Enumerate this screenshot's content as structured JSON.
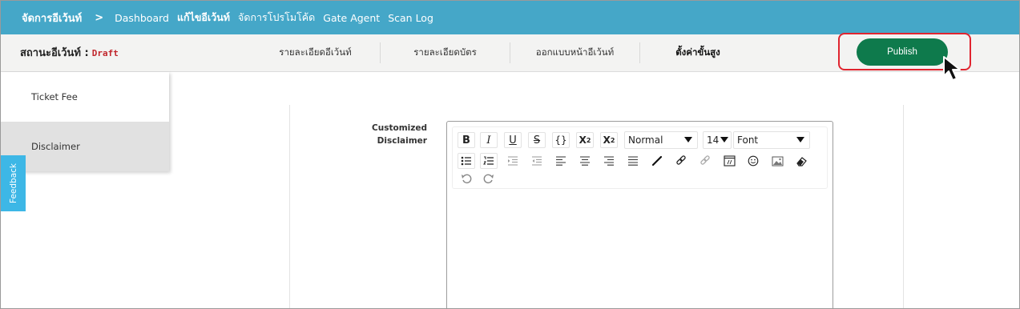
{
  "topnav": {
    "brand": "จัดการอีเว้นท์",
    "separator": ">",
    "links": [
      "Dashboard",
      "แก้ไขอีเว้นท์",
      "จัดการโปรโมโค้ด",
      "Gate Agent",
      "Scan Log"
    ]
  },
  "status": {
    "label": "สถานะอีเว้นท์ :",
    "value": "Draft"
  },
  "tabs": [
    "รายละเอียดอีเว้นท์",
    "รายละเอียดบัตร",
    "ออกแบบหน้าอีเว้นท์",
    "ตั้งค่าขั้นสูง"
  ],
  "publish": {
    "label": "Publish"
  },
  "sidemenu": {
    "items": [
      "Ticket Fee",
      "Disclaimer"
    ],
    "selected": "Disclaimer"
  },
  "feedback": {
    "label": "Feedback"
  },
  "form": {
    "label_line1": "Customized",
    "label_line2": "Disclaimer"
  },
  "editor": {
    "format_select": "Normal",
    "size_select": "14",
    "font_select": "Font",
    "toolbar_icons": [
      "bold-icon",
      "italic-icon",
      "underline-icon",
      "strikethrough-icon",
      "code-icon",
      "superscript-icon",
      "subscript-icon",
      "bullet-list-icon",
      "numbered-list-icon",
      "indent-icon",
      "outdent-icon",
      "align-left-icon",
      "align-center-icon",
      "align-right-icon",
      "align-justify-icon",
      "color-picker-icon",
      "link-icon",
      "unlink-icon",
      "code-view-icon",
      "emoji-icon",
      "image-icon",
      "eraser-icon",
      "undo-icon",
      "redo-icon"
    ]
  },
  "colors": {
    "topnav": "#45a7c8",
    "publish": "#0e7a4c",
    "highlight": "#e0242f",
    "draft": "#c1272d",
    "feedback": "#3db7e6"
  }
}
